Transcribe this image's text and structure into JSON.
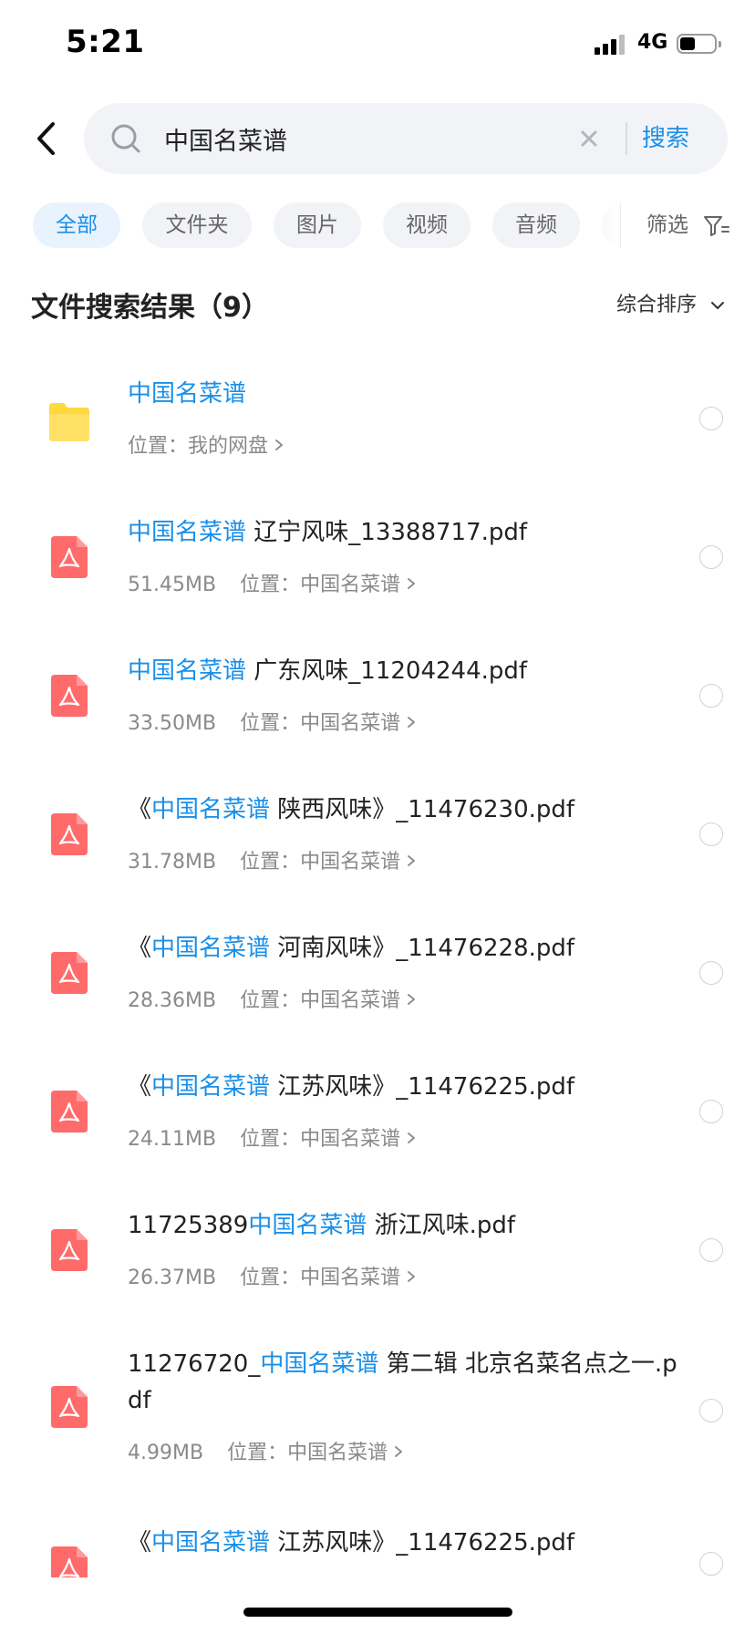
{
  "status_bar": {
    "time": "5:21",
    "network": "4G",
    "battery_level": 0.45
  },
  "search": {
    "query": "中国名菜谱",
    "submit_label": "搜索"
  },
  "filters": {
    "chips": [
      "全部",
      "文件夹",
      "图片",
      "视频",
      "音频"
    ],
    "active": "全部",
    "filter_label": "筛选"
  },
  "results": {
    "title": "文件搜索结果（9）",
    "sort_label": "综合排序",
    "items": [
      {
        "type": "folder",
        "name_parts": [
          "中国名菜谱"
        ],
        "highlight_index": 0,
        "size": "",
        "location_label": "位置：",
        "location": "我的网盘"
      },
      {
        "type": "pdf",
        "name_parts": [
          "中国名菜谱",
          "  辽宁风味_13388717.pdf"
        ],
        "highlight_index": 0,
        "size": "51.45MB",
        "location_label": "位置：",
        "location": "中国名菜谱"
      },
      {
        "type": "pdf",
        "name_parts": [
          "中国名菜谱",
          "  广东风味_11204244.pdf"
        ],
        "highlight_index": 0,
        "size": "33.50MB",
        "location_label": "位置：",
        "location": "中国名菜谱"
      },
      {
        "type": "pdf",
        "name_parts": [
          "《",
          "中国名菜谱",
          "  陕西风味》_11476230.pdf"
        ],
        "highlight_index": 1,
        "size": "31.78MB",
        "location_label": "位置：",
        "location": "中国名菜谱"
      },
      {
        "type": "pdf",
        "name_parts": [
          "《",
          "中国名菜谱",
          "  河南风味》_11476228.pdf"
        ],
        "highlight_index": 1,
        "size": "28.36MB",
        "location_label": "位置：",
        "location": "中国名菜谱"
      },
      {
        "type": "pdf",
        "name_parts": [
          "《",
          "中国名菜谱",
          "  江苏风味》_11476225.pdf"
        ],
        "highlight_index": 1,
        "size": "24.11MB",
        "location_label": "位置：",
        "location": "中国名菜谱"
      },
      {
        "type": "pdf",
        "name_parts": [
          "11725389",
          "中国名菜谱",
          "  浙江风味.pdf"
        ],
        "highlight_index": 1,
        "size": "26.37MB",
        "location_label": "位置：",
        "location": "中国名菜谱"
      },
      {
        "type": "pdf",
        "name_parts": [
          "11276720_",
          "中国名菜谱",
          "  第二辑  北京名菜名点之一.pdf"
        ],
        "highlight_index": 1,
        "size": "4.99MB",
        "location_label": "位置：",
        "location": "中国名菜谱"
      },
      {
        "type": "pdf",
        "name_parts": [
          "《",
          "中国名菜谱",
          "  江苏风味》_11476225.pdf"
        ],
        "highlight_index": 1,
        "size": "",
        "location_label": "",
        "location": ""
      }
    ]
  },
  "colors": {
    "accent": "#1a8fe8",
    "pdf_icon": "#ff6b6b",
    "folder_icon": "#ffd83d"
  }
}
